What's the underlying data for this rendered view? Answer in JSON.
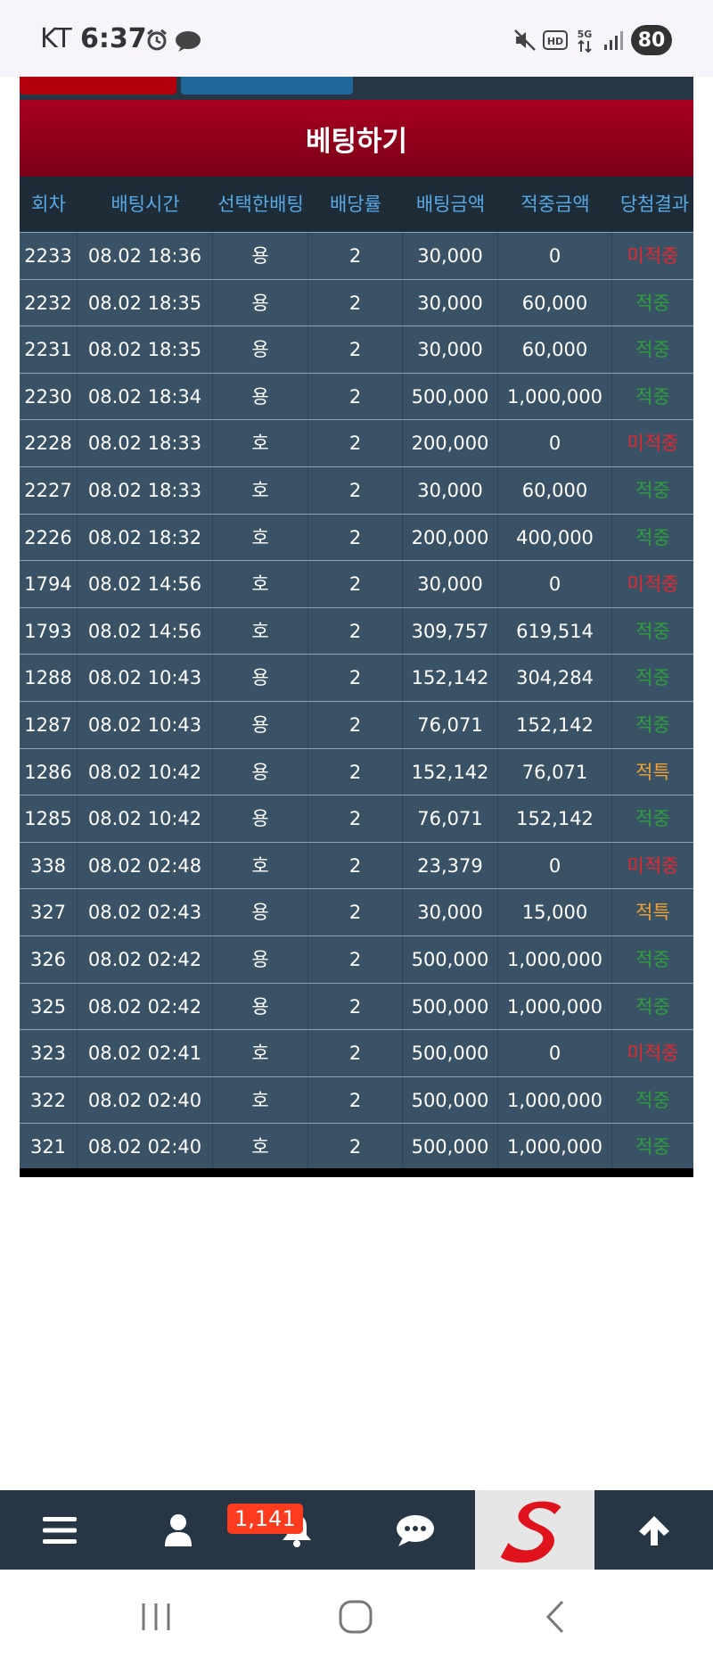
{
  "status_bar": {
    "carrier": "KT",
    "time": "6:37",
    "battery": "80"
  },
  "page": {
    "title": "베팅하기"
  },
  "table": {
    "headers": [
      "회차",
      "배팅시간",
      "선택한배팅",
      "배당률",
      "배팅금액",
      "적중금액",
      "당첨결과"
    ],
    "rows": [
      [
        "2233",
        "08.02 18:36",
        "용",
        "2",
        "30,000",
        "0",
        "미적중"
      ],
      [
        "2232",
        "08.02 18:35",
        "용",
        "2",
        "30,000",
        "60,000",
        "적중"
      ],
      [
        "2231",
        "08.02 18:35",
        "용",
        "2",
        "30,000",
        "60,000",
        "적중"
      ],
      [
        "2230",
        "08.02 18:34",
        "용",
        "2",
        "500,000",
        "1,000,000",
        "적중"
      ],
      [
        "2228",
        "08.02 18:33",
        "호",
        "2",
        "200,000",
        "0",
        "미적중"
      ],
      [
        "2227",
        "08.02 18:33",
        "호",
        "2",
        "30,000",
        "60,000",
        "적중"
      ],
      [
        "2226",
        "08.02 18:32",
        "호",
        "2",
        "200,000",
        "400,000",
        "적중"
      ],
      [
        "1794",
        "08.02 14:56",
        "호",
        "2",
        "30,000",
        "0",
        "미적중"
      ],
      [
        "1793",
        "08.02 14:56",
        "호",
        "2",
        "309,757",
        "619,514",
        "적중"
      ],
      [
        "1288",
        "08.02 10:43",
        "용",
        "2",
        "152,142",
        "304,284",
        "적중"
      ],
      [
        "1287",
        "08.02 10:43",
        "용",
        "2",
        "76,071",
        "152,142",
        "적중"
      ],
      [
        "1286",
        "08.02 10:42",
        "용",
        "2",
        "152,142",
        "76,071",
        "적특"
      ],
      [
        "1285",
        "08.02 10:42",
        "용",
        "2",
        "76,071",
        "152,142",
        "적중"
      ],
      [
        "338",
        "08.02 02:48",
        "호",
        "2",
        "23,379",
        "0",
        "미적중"
      ],
      [
        "327",
        "08.02 02:43",
        "용",
        "2",
        "30,000",
        "15,000",
        "적특"
      ],
      [
        "326",
        "08.02 02:42",
        "용",
        "2",
        "500,000",
        "1,000,000",
        "적중"
      ],
      [
        "325",
        "08.02 02:42",
        "용",
        "2",
        "500,000",
        "1,000,000",
        "적중"
      ],
      [
        "323",
        "08.02 02:41",
        "호",
        "2",
        "500,000",
        "0",
        "미적중"
      ],
      [
        "322",
        "08.02 02:40",
        "호",
        "2",
        "500,000",
        "1,000,000",
        "적중"
      ],
      [
        "321",
        "08.02 02:40",
        "호",
        "2",
        "500,000",
        "1,000,000",
        "적중"
      ]
    ]
  },
  "result_colors": {
    "적중": "#2f9e3c",
    "미적중": "#e8262e",
    "적특": "#f0a030"
  },
  "bottom_nav": {
    "items": [
      "menu-icon",
      "user-icon",
      "bell-icon",
      "chat-icon",
      "logo",
      "arrow-up-icon"
    ],
    "notification_count": "1,141"
  }
}
